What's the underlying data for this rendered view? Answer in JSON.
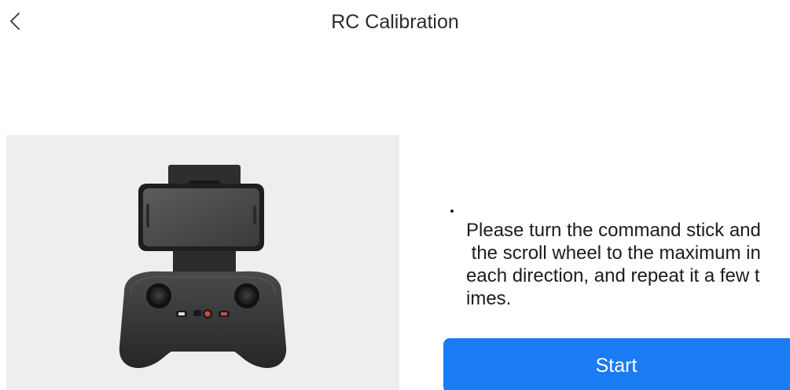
{
  "header": {
    "title": "RC Calibration",
    "back_icon": "chevron-left-icon"
  },
  "illustration": {
    "subject": "remote-controller-with-phone-icon"
  },
  "instruction": {
    "text": "Please turn the command stick and\n the scroll wheel to the maximum in\neach direction, and repeat it a few t\nimes."
  },
  "actions": {
    "start_label": "Start"
  },
  "colors": {
    "accent": "#1a7cf4",
    "panel_background": "#eeeeee",
    "text": "#1c1c1c"
  }
}
